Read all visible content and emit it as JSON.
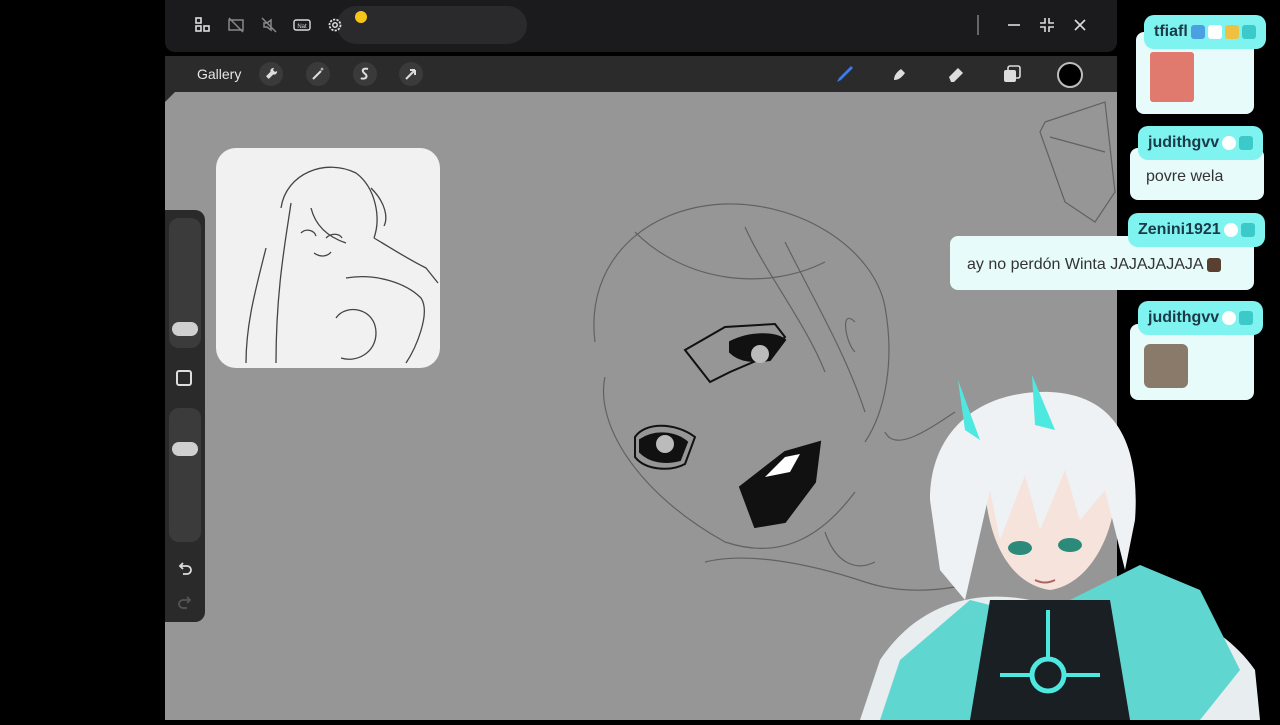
{
  "window_bar": {
    "icons": [
      "grid-icon",
      "screen-off-icon",
      "mute-icon",
      "nat-icon",
      "gear-icon"
    ],
    "nat_label": "Nat",
    "controls": [
      "minimize-icon",
      "collapse-icon",
      "close-icon"
    ]
  },
  "toolbar": {
    "gallery_label": "Gallery",
    "actions": [
      "wrench-icon",
      "magic-wand-icon",
      "selection-icon",
      "transform-arrow-icon"
    ],
    "tools": [
      "brush-icon",
      "smudge-icon",
      "eraser-icon",
      "layers-icon"
    ],
    "active_tool": "brush-icon",
    "active_color": "#000000",
    "accent": "#3a7bf0"
  },
  "canvas": {
    "background": "#969696",
    "reference_label": "reference-sketch"
  },
  "chat": {
    "accent": "#7ff3f0",
    "messages": [
      {
        "user": "tfiafl",
        "text": "",
        "has_image": true
      },
      {
        "user": "judithgvv",
        "text": "povre wela",
        "has_image": false
      },
      {
        "user": "Zenini1921",
        "text": "ay no perdón Winta JAJAJAJAJA",
        "has_image": false
      },
      {
        "user": "judithgvv",
        "text": "",
        "has_image": true
      }
    ]
  }
}
